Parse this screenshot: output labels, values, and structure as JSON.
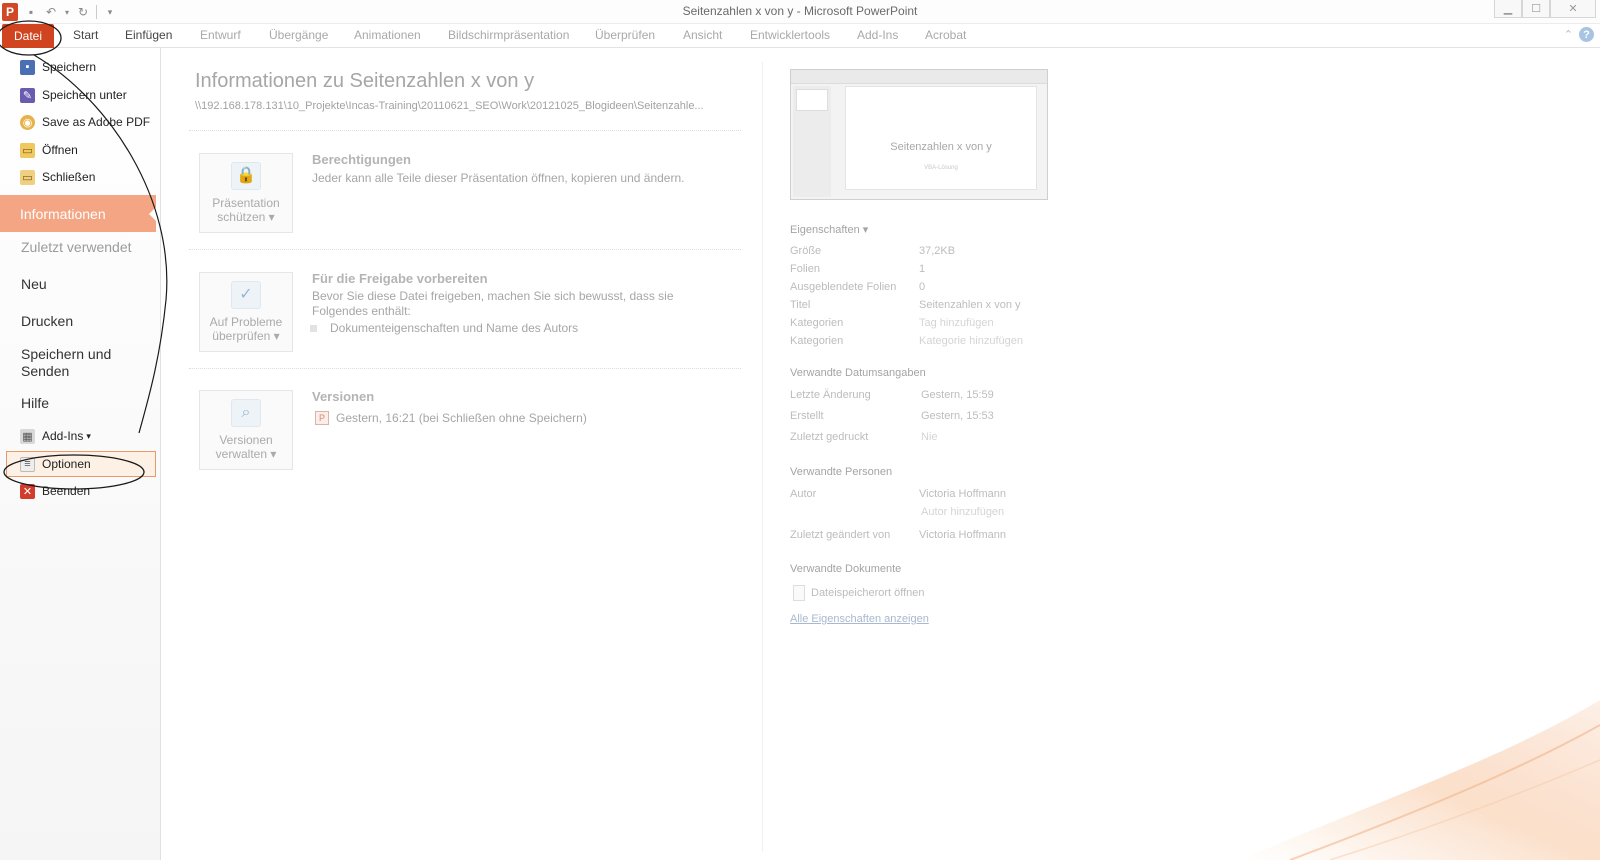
{
  "window": {
    "title": "Seitenzahlen x von y  -  Microsoft PowerPoint",
    "app_logo": "P",
    "controls": {
      "minimize": "▁",
      "maximize": "☐",
      "close": "✕"
    }
  },
  "qat": {
    "icons": [
      "save-icon",
      "undo-icon",
      "dropdown-icon",
      "redo-icon",
      "customize-icon"
    ]
  },
  "ribbon": {
    "tabs": [
      {
        "label": "Datei"
      },
      {
        "label": "Start"
      },
      {
        "label": "Einfügen"
      },
      {
        "label": "Entwurf"
      },
      {
        "label": "Übergänge"
      },
      {
        "label": "Animationen"
      },
      {
        "label": "Bildschirmpräsentation"
      },
      {
        "label": "Überprüfen"
      },
      {
        "label": "Ansicht"
      },
      {
        "label": "Entwicklertools"
      },
      {
        "label": "Add-Ins"
      },
      {
        "label": "Acrobat"
      }
    ],
    "help": "?",
    "collapse": "⌃"
  },
  "nav": {
    "commands": [
      {
        "label": "Speichern",
        "icon": "save-icon",
        "glyph": "▪"
      },
      {
        "label": "Speichern unter",
        "icon": "save-as-icon",
        "glyph": "✎"
      },
      {
        "label": "Save as Adobe PDF",
        "icon": "adobe-pdf-icon",
        "glyph": "◉"
      },
      {
        "label": "Öffnen",
        "icon": "open-folder-icon",
        "glyph": "▭"
      },
      {
        "label": "Schließen",
        "icon": "close-folder-icon",
        "glyph": "▭"
      }
    ],
    "selected": "Informationen",
    "items": [
      {
        "label": "Zuletzt verwendet"
      },
      {
        "label": "Neu"
      },
      {
        "label": "Drucken"
      },
      {
        "label": "Speichern und Senden"
      },
      {
        "label": "Hilfe"
      }
    ],
    "bottom": [
      {
        "label": "Add-Ins",
        "icon": "addins-icon",
        "glyph": "▦",
        "dropdown": "▾"
      },
      {
        "label": "Optionen",
        "icon": "options-icon",
        "glyph": "≡"
      },
      {
        "label": "Beenden",
        "icon": "exit-icon",
        "glyph": "✕"
      }
    ]
  },
  "info": {
    "title": "Informationen zu Seitenzahlen x von y",
    "path": "\\\\192.168.178.131\\10_Projekte\\Incas-Training\\20110621_SEO\\Work\\20121025_Blogideen\\Seitenzahle...",
    "sections": [
      {
        "button_line1": "Präsentation",
        "button_line2": "schützen ▾",
        "title": "Berechtigungen",
        "text": "Jeder kann alle Teile dieser Präsentation öffnen, kopieren und ändern."
      },
      {
        "button_line1": "Auf Probleme",
        "button_line2": "überprüfen ▾",
        "title": "Für die Freigabe vorbereiten",
        "text": "Bevor Sie diese Datei freigeben, machen Sie sich bewusst, dass sie Folgendes enthält:",
        "bullet": "Dokumenteigenschaften und Name des Autors"
      },
      {
        "button_line1": "Versionen",
        "button_line2": "verwalten ▾",
        "title": "Versionen",
        "version_entry": "Gestern, 16:21 (bei Schließen ohne Speichern)"
      }
    ]
  },
  "preview": {
    "slide_title": "Seitenzahlen x von y",
    "slide_subtitle": "VBA-Lösung"
  },
  "properties": {
    "header": "Eigenschaften ▾",
    "rows": [
      {
        "label": "Größe",
        "value": "37,2KB"
      },
      {
        "label": "Folien",
        "value": "1"
      },
      {
        "label": "Ausgeblendete Folien",
        "value": "0"
      },
      {
        "label": "Titel",
        "value": "Seitenzahlen x von y"
      },
      {
        "label": "Kategorien",
        "value": "Tag hinzufügen"
      },
      {
        "label": "Kategorien",
        "value": "Kategorie hinzufügen"
      }
    ],
    "dates_header": "Verwandte Datumsangaben",
    "dates": [
      {
        "label": "Letzte Änderung",
        "value": "Gestern, 15:59"
      },
      {
        "label": "Erstellt",
        "value": "Gestern, 15:53"
      },
      {
        "label": "Zuletzt gedruckt",
        "value": "Nie"
      }
    ],
    "people_header": "Verwandte Personen",
    "people": {
      "author_label": "Autor",
      "author_value": "Victoria Hoffmann",
      "add_author": "Autor hinzufügen",
      "modified_label": "Zuletzt geändert von",
      "modified_value": "Victoria Hoffmann"
    },
    "docs_header": "Verwandte Dokumente",
    "open_location": "Dateispeicherort öffnen",
    "show_all": "Alle Eigenschaften anzeigen"
  },
  "colors": {
    "accent": "#d04520",
    "selection": "#f4a684",
    "annotation": "#222222"
  }
}
